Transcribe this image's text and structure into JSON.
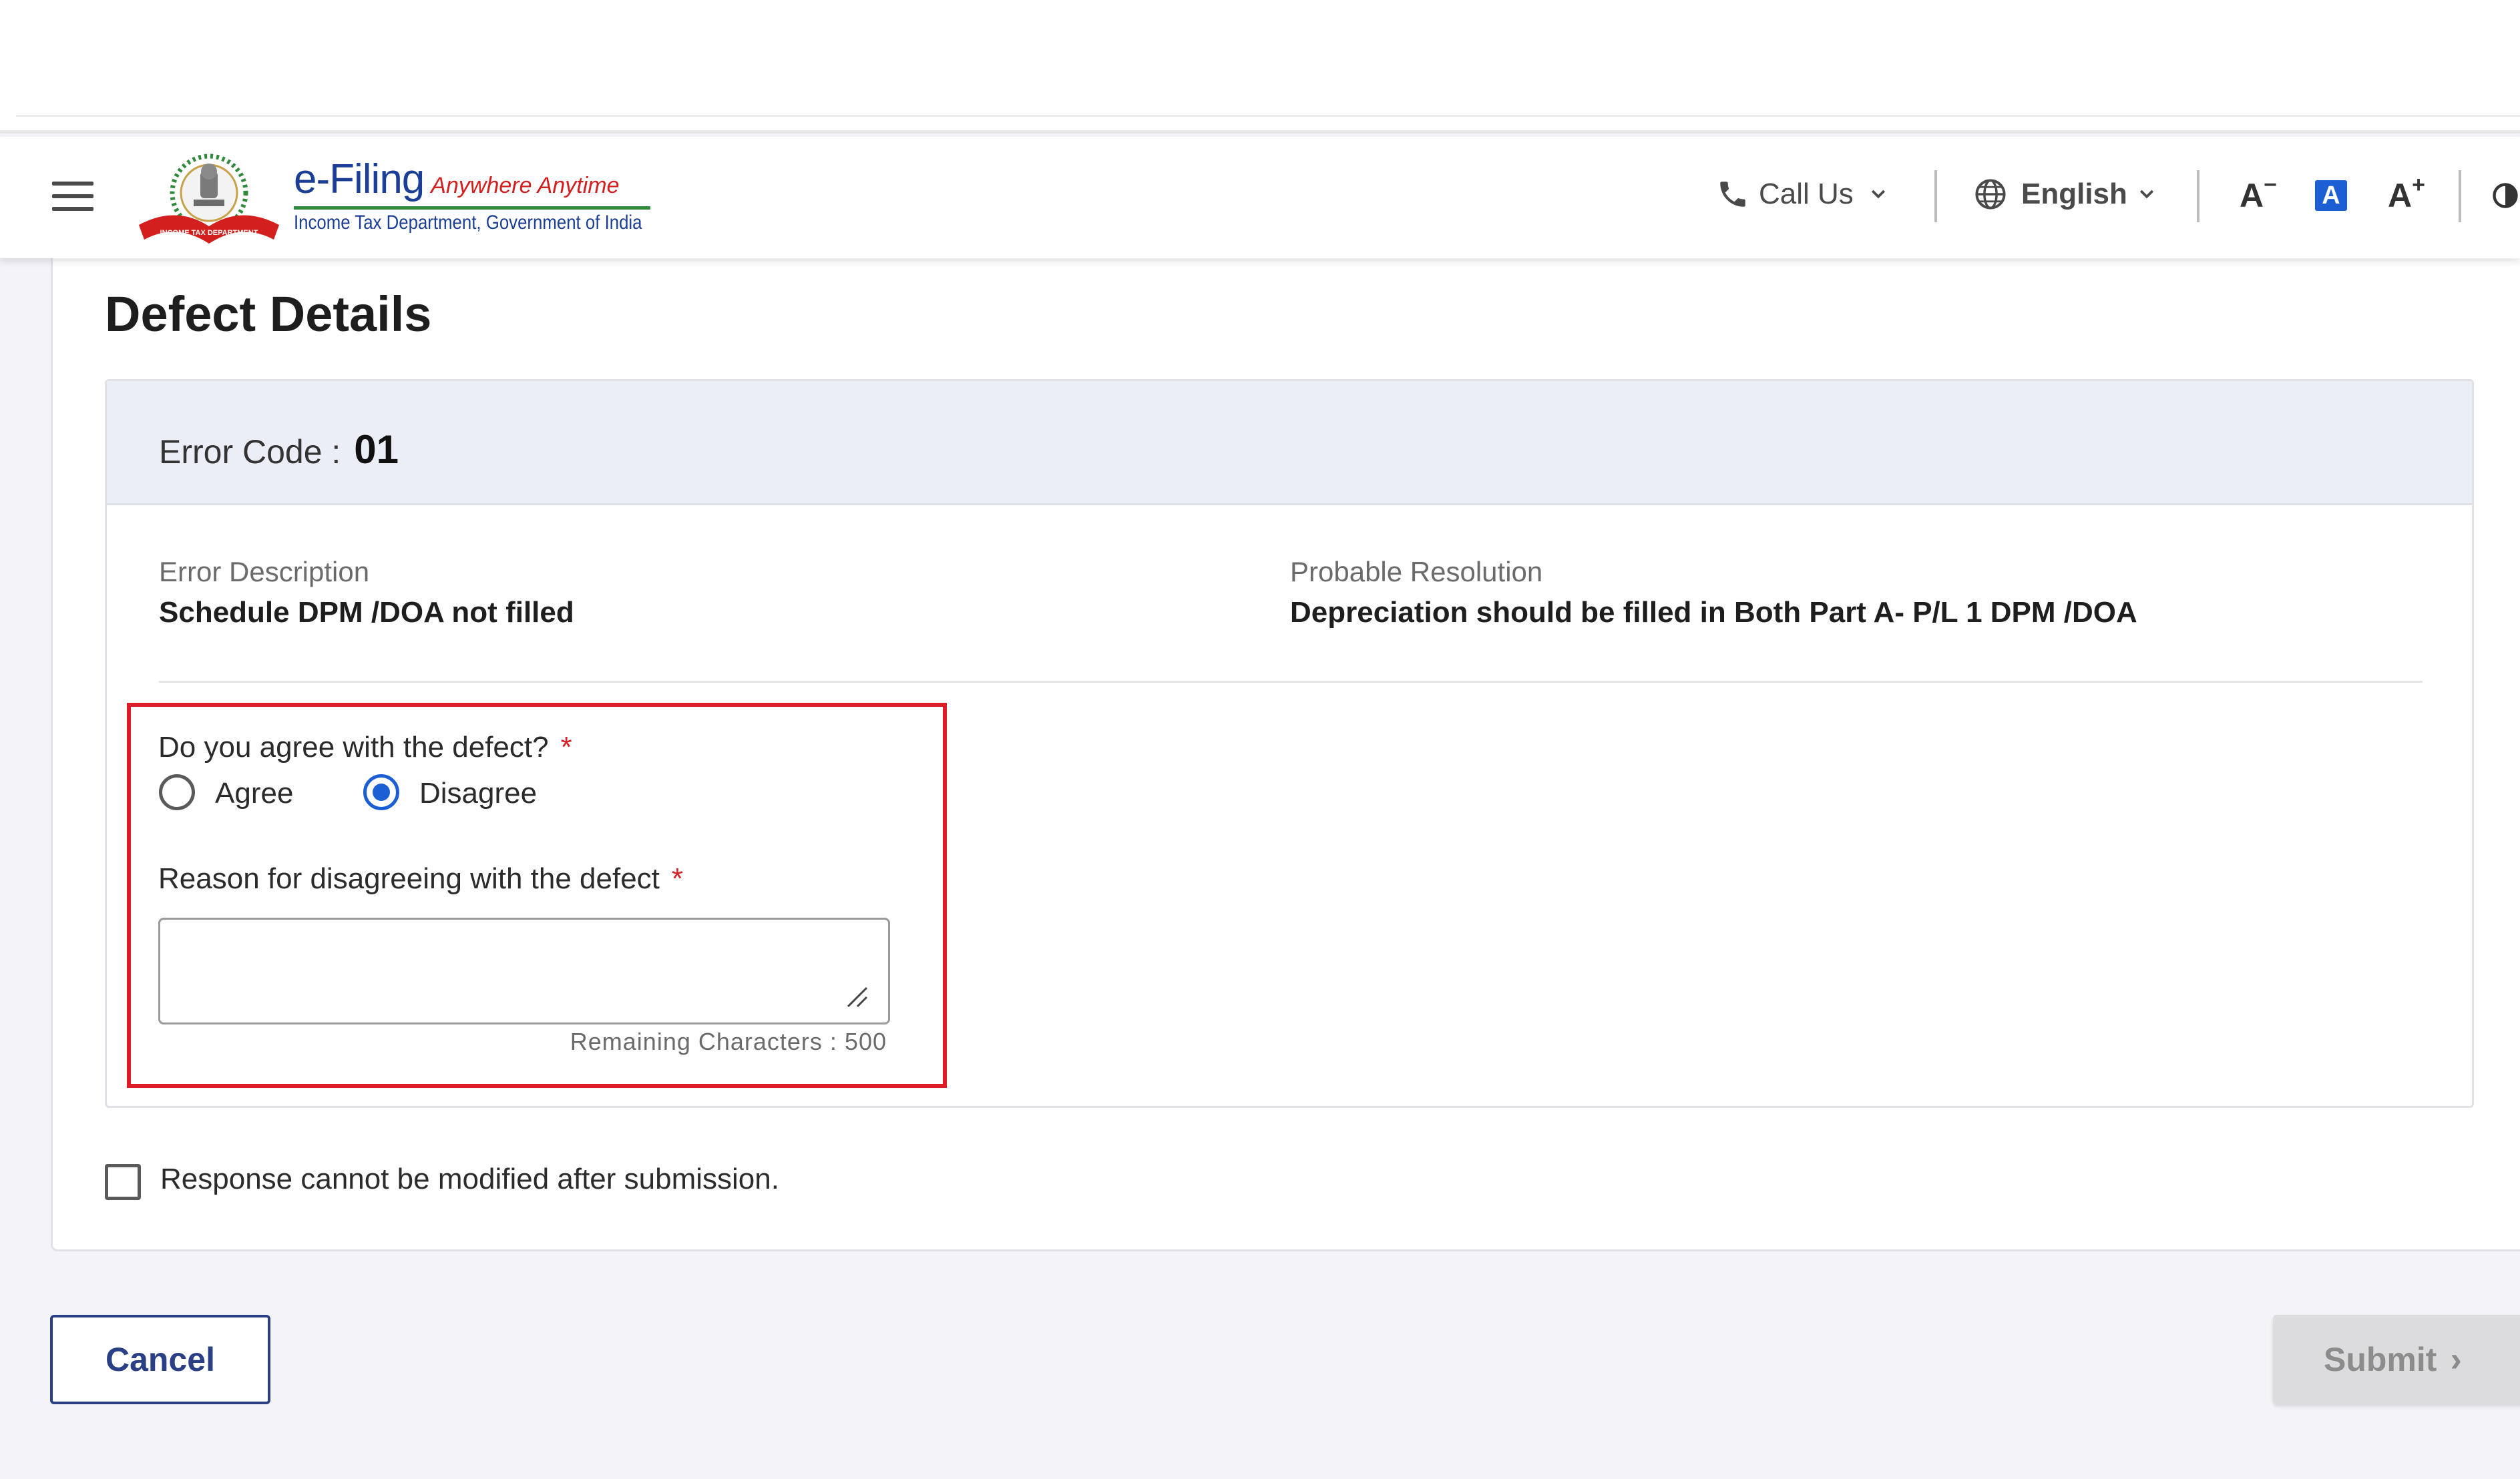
{
  "header": {
    "brand_name": "e-Filing",
    "brand_tagline": "Anywhere Anytime",
    "brand_subtitle": "Income Tax Department, Government of India",
    "emblem_ribbon_text": "INCOME TAX DEPARTMENT",
    "call_us": "Call Us",
    "language": "English",
    "font_decrease": "A",
    "font_default": "A",
    "font_increase": "A",
    "icons": [
      "menu-icon",
      "phone-icon",
      "chevron-down-icon",
      "globe-icon",
      "contrast-icon"
    ],
    "colors": {
      "brand_blue": "#1b3f96",
      "brand_red": "#d3201f",
      "brand_green": "#2f8a3c",
      "accent": "#1c5fd4"
    }
  },
  "page": {
    "title": "Defect Details"
  },
  "defect": {
    "error_code_label": "Error Code :",
    "error_code_value": "01",
    "error_description_label": "Error Description",
    "error_description_value": "Schedule DPM /DOA not filled",
    "probable_resolution_label": "Probable Resolution",
    "probable_resolution_value": "Depreciation should be filled in Both Part A- P/L 1 DPM /DOA",
    "agree_question": "Do you agree with the defect?",
    "required_mark": "*",
    "options": [
      {
        "label": "Agree",
        "selected": false
      },
      {
        "label": "Disagree",
        "selected": true
      }
    ],
    "reason_label": "Reason for disagreeing with the defect",
    "reason_value": "",
    "remaining_characters": "Remaining Characters : 500"
  },
  "confirm": {
    "checkbox_label": "Response cannot be modified after submission.",
    "checked": false
  },
  "actions": {
    "cancel_label": "Cancel",
    "submit_label": "Submit",
    "submit_enabled": false
  }
}
